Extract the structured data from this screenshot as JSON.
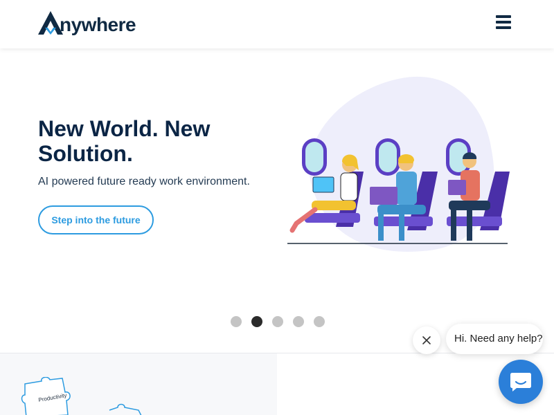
{
  "header": {
    "logo_text": "nywhere",
    "menu_icon": "hamburger-menu-icon"
  },
  "hero": {
    "title": "New World. New Solution.",
    "subtitle": "AI powered future ready work environment.",
    "cta_label": "Step into the future"
  },
  "carousel": {
    "slide_count": 5,
    "active_index": 1
  },
  "lower": {
    "puzzle_label": "Productivity"
  },
  "chat": {
    "greeting": "Hi. Need any help?",
    "close_icon": "close-icon",
    "launcher_icon": "chat-icon"
  },
  "colors": {
    "brand_dark": "#0b2545",
    "accent": "#2c9be0",
    "chat_blue": "#2b7fd9",
    "seat_purple": "#5b3fc4"
  }
}
